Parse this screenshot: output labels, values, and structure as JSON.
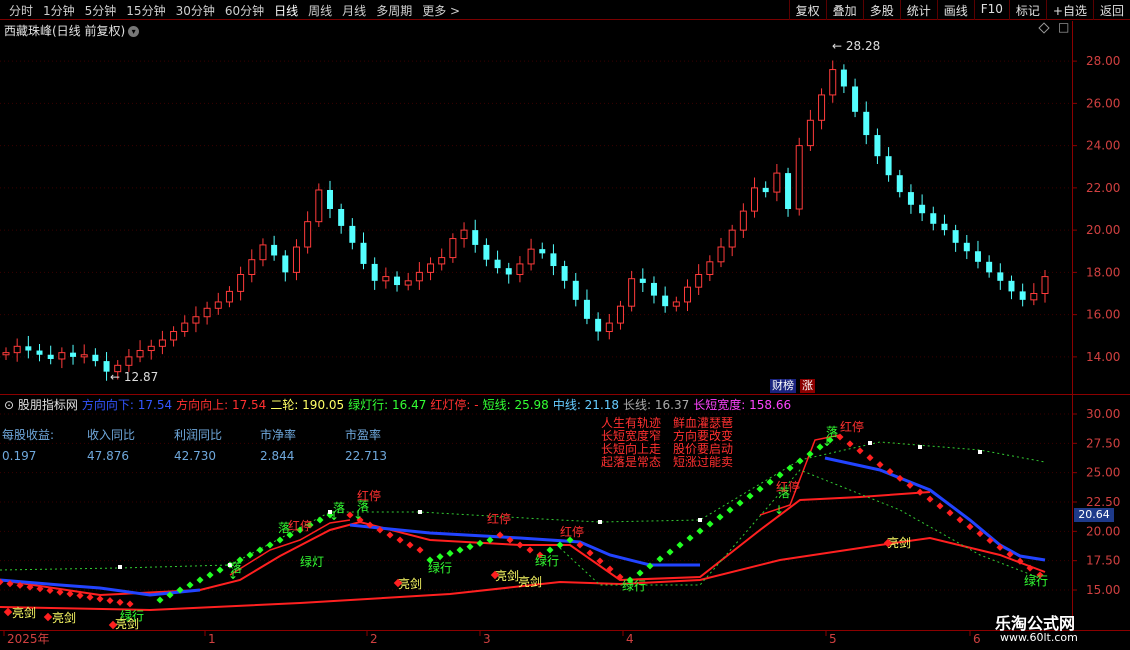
{
  "toolbar": {
    "periods": [
      "分时",
      "1分钟",
      "5分钟",
      "15分钟",
      "30分钟",
      "60分钟",
      "日线",
      "周线",
      "月线",
      "多周期",
      "更多 >"
    ],
    "active": "日线",
    "tools": [
      "复权",
      "叠加",
      "多股",
      "统计",
      "画线",
      "F10",
      "标记",
      "+自选",
      "返回"
    ]
  },
  "main": {
    "title": "西藏珠峰(日线 前复权)",
    "high_label": "28.28",
    "low_label": "12.87",
    "y_ticks": [
      "28.00",
      "26.00",
      "24.00",
      "22.00",
      "20.00",
      "18.00",
      "16.00",
      "14.00"
    ],
    "badges": [
      "财榜",
      "涨"
    ]
  },
  "indicator": {
    "name": "股朋指标网",
    "values": [
      {
        "t": "方向向下: 17.54",
        "c": "#3355ff"
      },
      {
        "t": "方向向上: 17.54",
        "c": "#ff3030"
      },
      {
        "t": "二轮: 190.05",
        "c": "#ffff66"
      },
      {
        "t": "绿灯行: 16.47",
        "c": "#33ff33"
      },
      {
        "t": "红灯停: -",
        "c": "#ff3030"
      },
      {
        "t": "短线: 25.98",
        "c": "#33ff33"
      },
      {
        "t": "中线: 21.18",
        "c": "#66ccff"
      },
      {
        "t": "长线: 16.37",
        "c": "#aaaaaa"
      },
      {
        "t": "长短宽度: 158.66",
        "c": "#ff44ff"
      }
    ],
    "fin_labels": [
      "每股收益:",
      "收入同比",
      "利润同比",
      "市净率",
      "市盈率"
    ],
    "fin_values": [
      "0.197",
      "47.876",
      "42.730",
      "2.844",
      "22.713"
    ],
    "poem_left": [
      "人生有轨迹",
      "长短宽度窄",
      "长短向上走",
      "起落是常态"
    ],
    "poem_right": [
      "鲜血灌瑟琶",
      "方向要改变",
      "股价要启动",
      "短涨过能卖"
    ],
    "y_ticks": [
      "30.00",
      "27.50",
      "25.00",
      "22.50",
      "20.00",
      "17.50",
      "15.00"
    ],
    "current": "20.64",
    "labels": {
      "luo": "落",
      "hongting": "红停",
      "lvxing": "绿行",
      "liangjian": "亮剑",
      "lvdeng": "绿灯"
    }
  },
  "xaxis": {
    "labels": [
      "2025年",
      "1",
      "2",
      "3",
      "4",
      "5",
      "6"
    ]
  },
  "watermark": {
    "title": "乐淘公式网",
    "url": "www.60lt.com"
  },
  "chart_data": {
    "type": "candlestick",
    "title": "西藏珠峰(日线 前复权)",
    "ylim": [
      13,
      29
    ],
    "closes": [
      14.2,
      14.5,
      14.3,
      14.1,
      13.9,
      14.2,
      14.0,
      14.1,
      13.8,
      13.3,
      13.6,
      14.0,
      14.3,
      14.5,
      14.8,
      15.2,
      15.6,
      15.9,
      16.3,
      16.6,
      17.1,
      17.9,
      18.6,
      19.3,
      18.8,
      18.0,
      19.2,
      20.4,
      21.9,
      21.0,
      20.2,
      19.4,
      18.4,
      17.6,
      17.8,
      17.4,
      17.6,
      18.0,
      18.4,
      18.7,
      19.6,
      20.0,
      19.3,
      18.6,
      18.2,
      17.9,
      18.4,
      19.1,
      18.9,
      18.3,
      17.6,
      16.7,
      15.8,
      15.2,
      15.6,
      16.4,
      17.7,
      17.5,
      16.9,
      16.4,
      16.6,
      17.3,
      17.9,
      18.5,
      19.2,
      20.0,
      20.9,
      22.0,
      21.8,
      22.7,
      21.0,
      24.0,
      25.2,
      26.4,
      27.6,
      26.8,
      25.6,
      24.5,
      23.5,
      22.6,
      21.8,
      21.2,
      20.8,
      20.3,
      20.0,
      19.4,
      19.0,
      18.5,
      18.0,
      17.6,
      17.1,
      16.7,
      17.0,
      17.8
    ]
  }
}
